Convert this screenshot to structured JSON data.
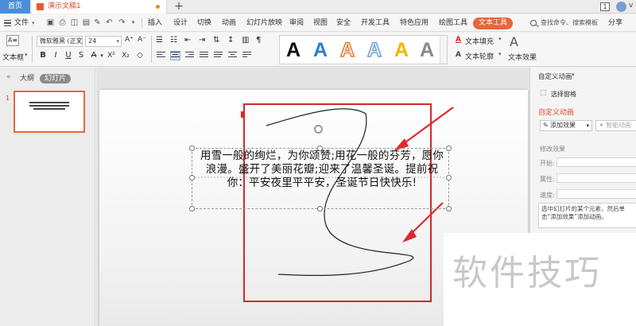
{
  "titlebar": {
    "home_tab": "首页",
    "doc_title": "演示文稿1",
    "add_tab": "+",
    "page_indicator": "1",
    "user_label": "v"
  },
  "menubar": {
    "file": "文件",
    "tabs": [
      "插入",
      "设计",
      "切换",
      "动画",
      "幻灯片放映",
      "审阅",
      "视图",
      "安全",
      "开发工具",
      "特色应用",
      "绘图工具",
      "文本工具"
    ],
    "active_tab": "文本工具",
    "search_placeholder": "查找命令、搜索模板",
    "share": "分享"
  },
  "ribbon": {
    "text_box_label": "文本框",
    "font_name": "微软雅黑 (正文",
    "font_size": "24",
    "wordart_colors": [
      "#111111",
      "#2f7fd0",
      "#e77a2a",
      "#6a9ed6",
      "#f2b800",
      "#8a8a8a"
    ],
    "wordart_letter": "A",
    "text_fill": "文本填充",
    "text_outline": "文本轮廓",
    "text_effect": "文本效果",
    "accent_color": "#e8663a"
  },
  "left_panel": {
    "outline_tab": "大纲",
    "slides_tab": "幻灯片",
    "slide_number": "1"
  },
  "slide": {
    "text": "用雪一般的绚烂，为你颂赞;用花一般的芬芳，愿你浪漫。盛开了美丽花瓣;迎来了温馨圣诞。提前祝你：平安夜里平平安，圣诞节日快快乐!"
  },
  "right_panel": {
    "header": "自定义动画",
    "select_pane": "选择窗格",
    "title": "自定义动画",
    "add_effect": "添加效果",
    "smart_animation": "智能动画",
    "modify_effect": "修改效果",
    "start_label": "开始:",
    "property_label": "属性:",
    "speed_label": "速度:",
    "hint": "选中幻灯片的某个元素，然后单击“添加效果”添加动画。"
  },
  "watermark": {
    "text": "软件技巧"
  }
}
